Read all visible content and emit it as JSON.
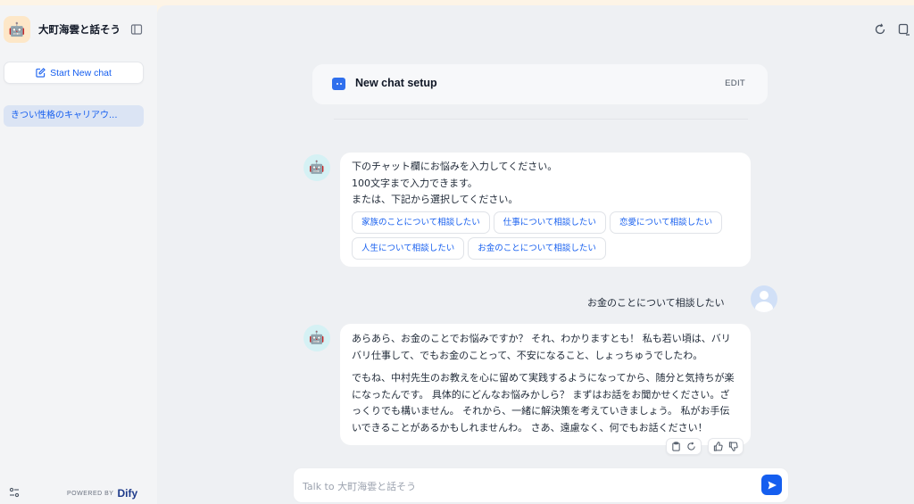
{
  "sidebar": {
    "app_title": "大町海雲と話そう",
    "new_chat_label": "Start New chat",
    "conversations": [
      {
        "label": "きつい性格のキャリアウ..."
      }
    ],
    "footer": {
      "powered_by": "POWERED BY",
      "brand": "Dify"
    }
  },
  "main": {
    "setup": {
      "title": "New chat setup",
      "edit_label": "EDIT"
    },
    "messages": {
      "opening": {
        "lines": [
          "下のチャット欄にお悩みを入力してください。",
          "100文字まで入力できます。",
          "または、下記から選択してください。"
        ],
        "suggestions": [
          "家族のことについて相談したい",
          "仕事について相談したい",
          "恋愛について相談したい",
          "人生について相談したい",
          "お金のことについて相談したい"
        ]
      },
      "user": "お金のことについて相談したい",
      "answer": {
        "paragraphs": [
          "あらあら、お金のことでお悩みですか？ それ、わかりますとも！ 私も若い頃は、バリバリ仕事して、でもお金のことって、不安になること、しょっちゅうでしたわ。",
          "でもね、中村先生のお教えを心に留めて実践するようになってから、随分と気持ちが楽になったんです。 具体的にどんなお悩みかしら？ まずはお話をお聞かせください。ざっくりでも構いません。 それから、一緒に解決策を考えていきましょう。 私がお手伝いできることがあるかもしれませんわ。 さあ、遠慮なく、何でもお話ください！"
        ]
      }
    },
    "input": {
      "placeholder": "Talk to 大町海雲と話そう"
    }
  },
  "icons": {
    "app": "robot-avatar-icon",
    "collapse": "sidebar-collapse-icon",
    "new_chat": "edit-icon",
    "settings": "sliders-icon",
    "refresh": "refresh-icon",
    "chat_list": "chat-list-icon",
    "copy": "clipboard-icon",
    "regenerate": "regenerate-icon",
    "like": "thumbs-up-icon",
    "dislike": "thumbs-down-icon",
    "send": "send-icon"
  },
  "colors": {
    "accent": "#155eef",
    "sidebar_bg": "#f3f4f6",
    "main_bg": "#eef0f3",
    "top_bar": "#fdf4e6"
  }
}
